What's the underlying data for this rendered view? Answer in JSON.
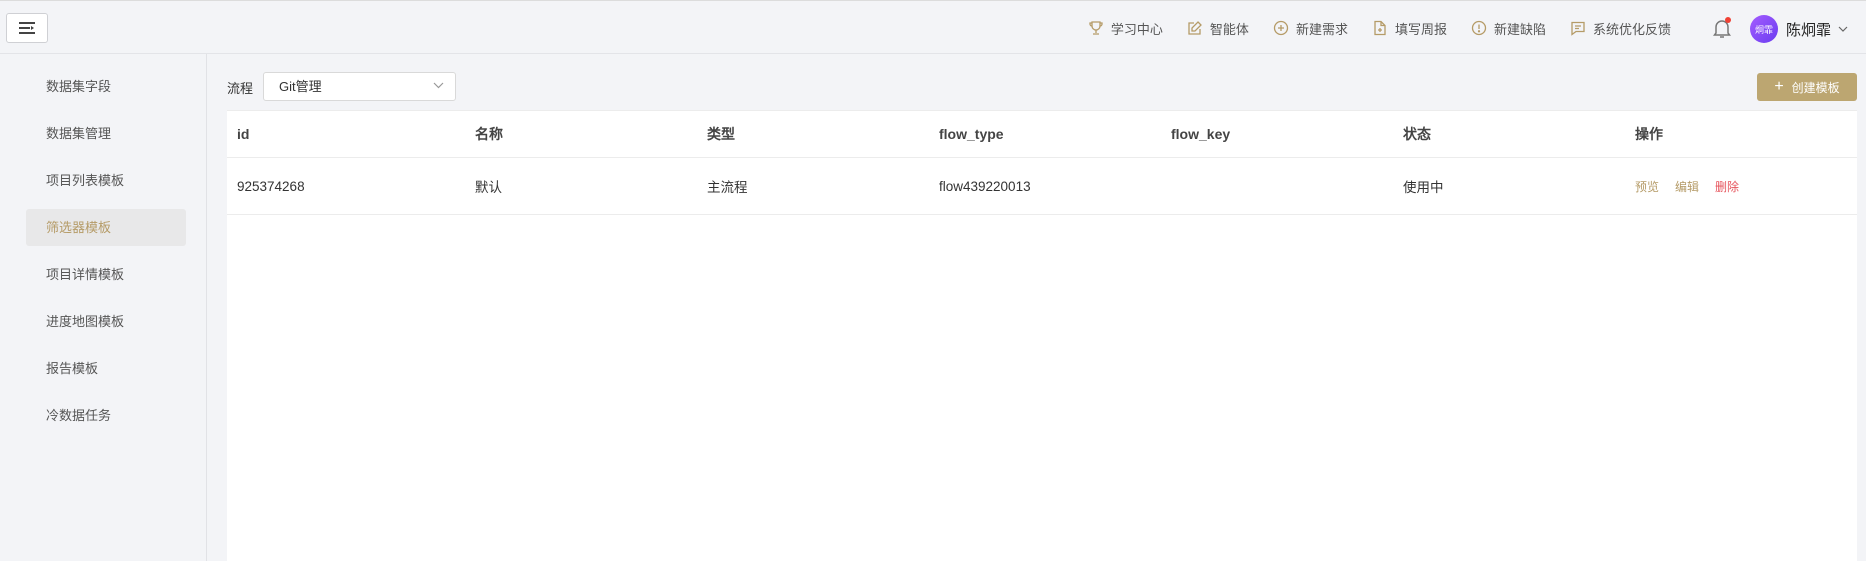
{
  "header": {
    "nav": [
      {
        "label": "学习中心",
        "icon": "trophy-icon"
      },
      {
        "label": "智能体",
        "icon": "edit-icon"
      },
      {
        "label": "新建需求",
        "icon": "plus-circle-icon"
      },
      {
        "label": "填写周报",
        "icon": "file-add-icon"
      },
      {
        "label": "新建缺陷",
        "icon": "alert-circle-icon"
      },
      {
        "label": "系统优化反馈",
        "icon": "message-icon"
      }
    ],
    "user": {
      "avatar_text": "炯霏",
      "name": "陈炯霏"
    }
  },
  "sidebar": {
    "items": [
      {
        "label": "数据集字段"
      },
      {
        "label": "数据集管理"
      },
      {
        "label": "项目列表模板"
      },
      {
        "label": "筛选器模板"
      },
      {
        "label": "项目详情模板"
      },
      {
        "label": "进度地图模板"
      },
      {
        "label": "报告模板"
      },
      {
        "label": "冷数据任务"
      }
    ],
    "active_index": 3
  },
  "filter": {
    "label": "流程",
    "value": "Git管理"
  },
  "create_button": {
    "label": "创建模板"
  },
  "table": {
    "columns": [
      "id",
      "名称",
      "类型",
      "flow_type",
      "flow_key",
      "状态",
      "操作"
    ],
    "rows": [
      {
        "id": "925374268",
        "name": "默认",
        "type": "主流程",
        "flow_type": "flow439220013",
        "flow_key": "",
        "status": "使用中"
      }
    ],
    "actions": {
      "preview": "预览",
      "edit": "编辑",
      "delete": "删除"
    }
  },
  "colors": {
    "accent": "#bca671",
    "active_text": "#b59b67",
    "danger": "#e6545c"
  }
}
